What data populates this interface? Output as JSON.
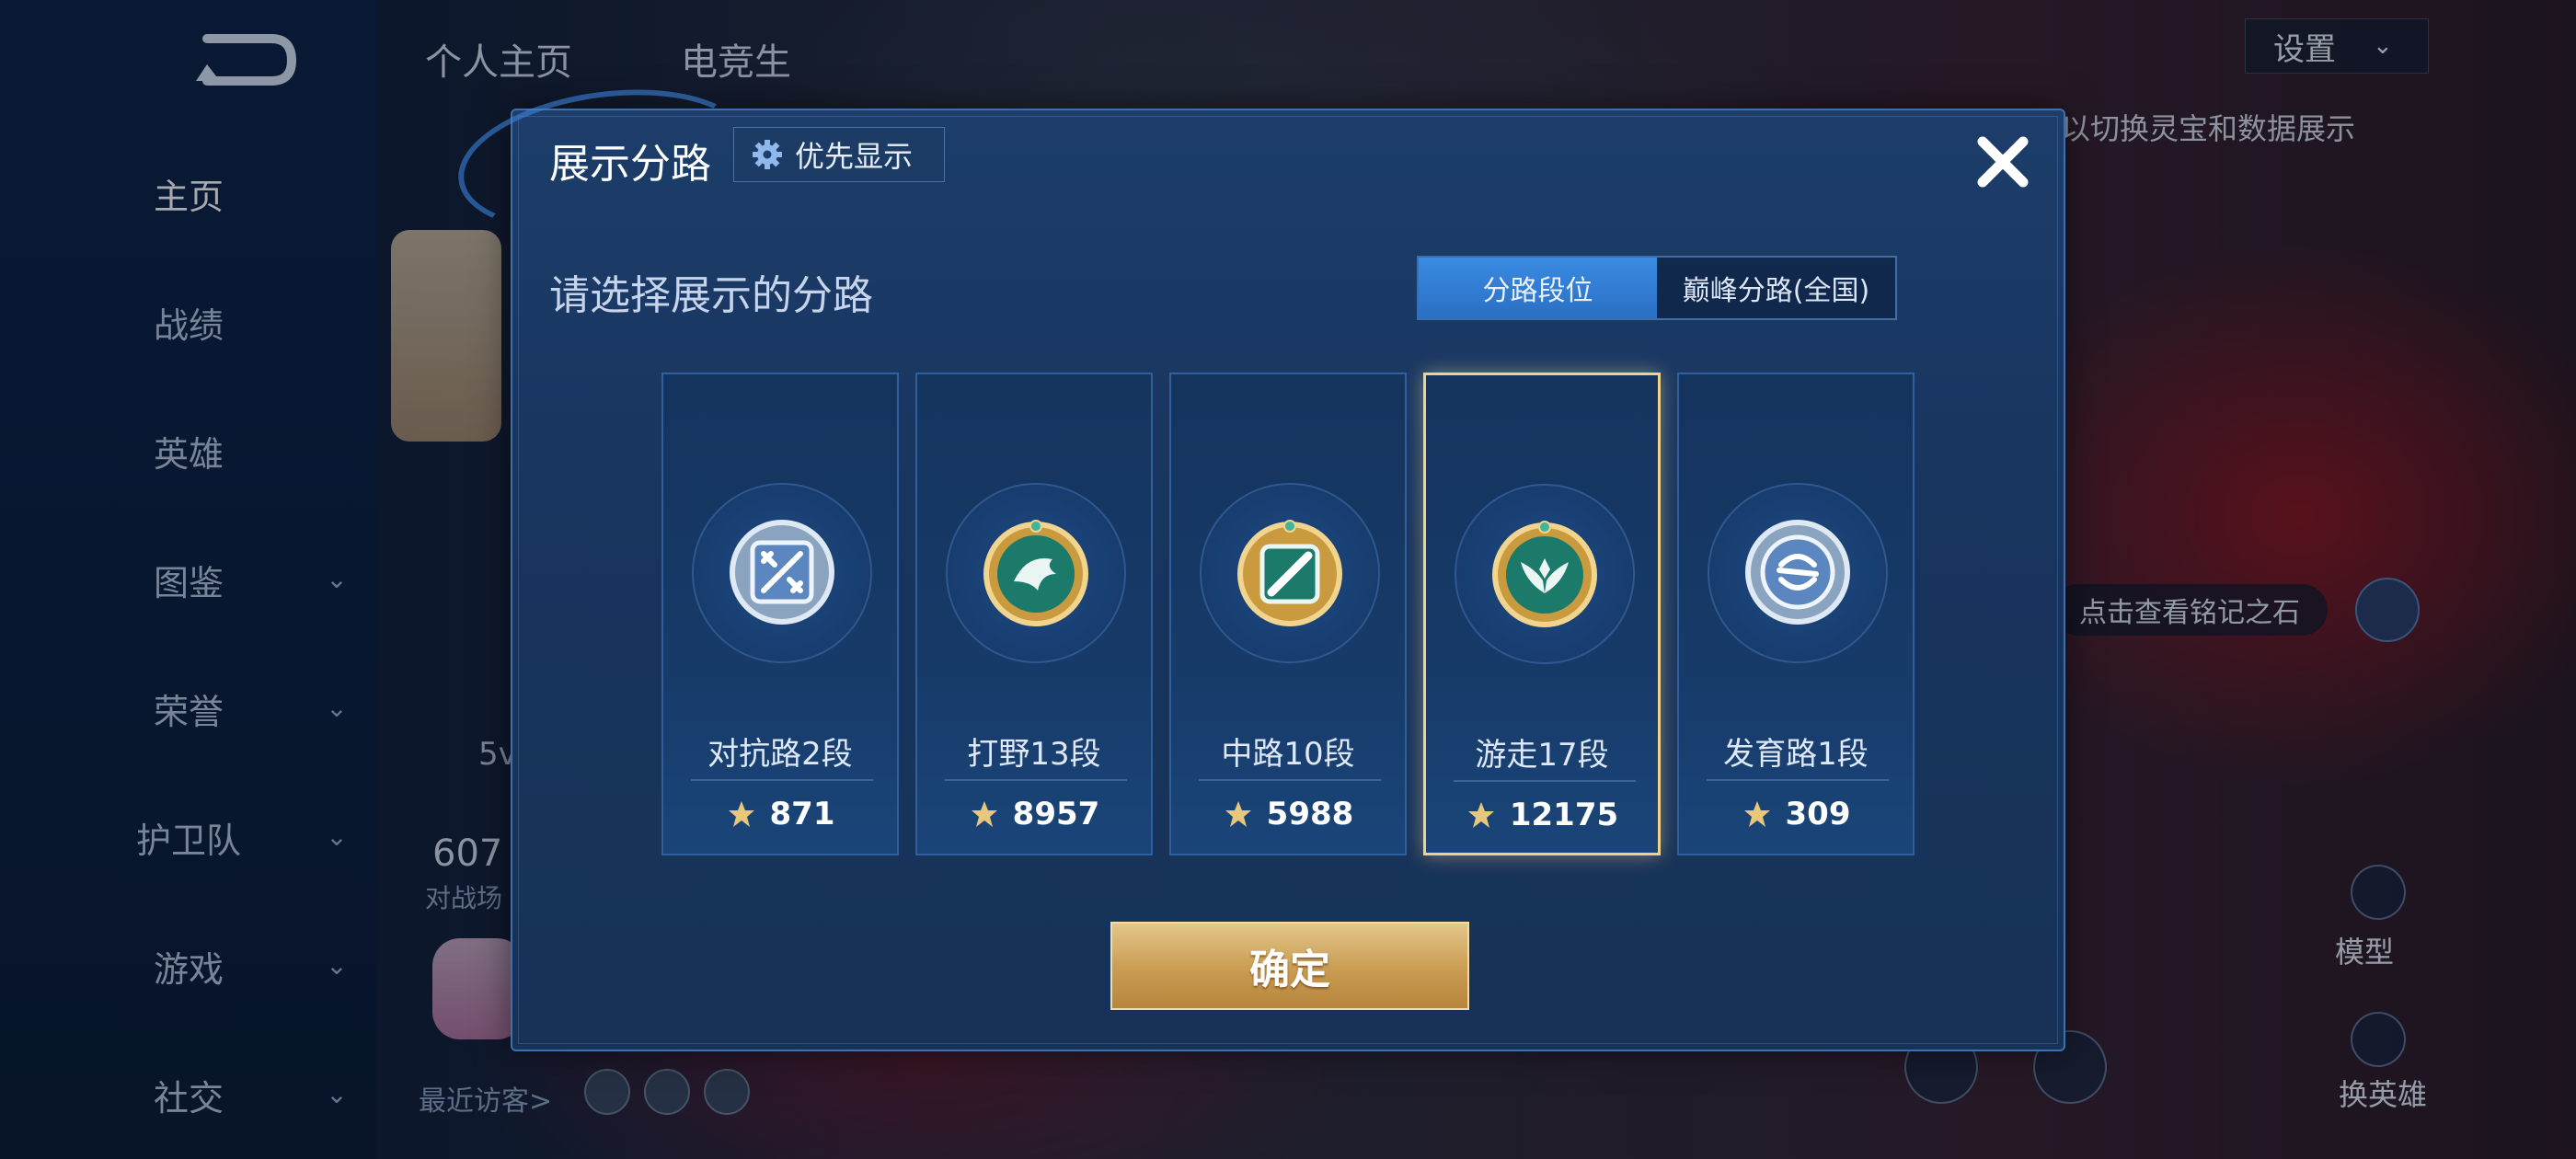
{
  "sidebar": {
    "items": [
      {
        "label": "主页",
        "active": true,
        "chevron": false
      },
      {
        "label": "战绩",
        "active": false,
        "chevron": false
      },
      {
        "label": "英雄",
        "active": false,
        "chevron": false
      },
      {
        "label": "图鉴",
        "active": false,
        "chevron": true
      },
      {
        "label": "荣誉",
        "active": false,
        "chevron": true
      },
      {
        "label": "护卫队",
        "active": false,
        "chevron": true
      },
      {
        "label": "游戏",
        "active": false,
        "chevron": true
      },
      {
        "label": "社交",
        "active": false,
        "chevron": true
      }
    ]
  },
  "header": {
    "tabs": [
      "个人主页",
      "电竞生"
    ],
    "settings_label": "设置",
    "hint": "以切换灵宝和数据展示"
  },
  "background": {
    "mark_text": "点击查看铭记之石",
    "model_label": "模型",
    "change_hero_label": "换英雄",
    "visitors_label": "最近访客>",
    "partial_count": "607",
    "partial_sub": "对战场",
    "partial_5": "5v"
  },
  "dialog": {
    "title": "展示分路",
    "priority_label": "优先显示",
    "subtitle": "请选择展示的分路",
    "segments": [
      {
        "label": "分路段位",
        "active": true
      },
      {
        "label": "巅峰分路(全国)",
        "active": false
      }
    ],
    "lanes": [
      {
        "label": "对抗路2段",
        "score": "871",
        "emblem": "clash-lane-icon",
        "tier": "silver",
        "selected": false
      },
      {
        "label": "打野13段",
        "score": "8957",
        "emblem": "jungle-dragon-icon",
        "tier": "gold",
        "selected": false
      },
      {
        "label": "中路10段",
        "score": "5988",
        "emblem": "mid-lane-icon",
        "tier": "gold",
        "selected": false
      },
      {
        "label": "游走17段",
        "score": "12175",
        "emblem": "roam-wings-icon",
        "tier": "gold",
        "selected": true
      },
      {
        "label": "发育路1段",
        "score": "309",
        "emblem": "farm-lane-icon",
        "tier": "silver",
        "selected": false
      }
    ],
    "confirm_label": "确定"
  },
  "colors": {
    "dialog_bg": "#18355f",
    "accent_blue": "#2a6fc4",
    "gold": "#c99c52",
    "selected_border": "#f0d28a"
  }
}
